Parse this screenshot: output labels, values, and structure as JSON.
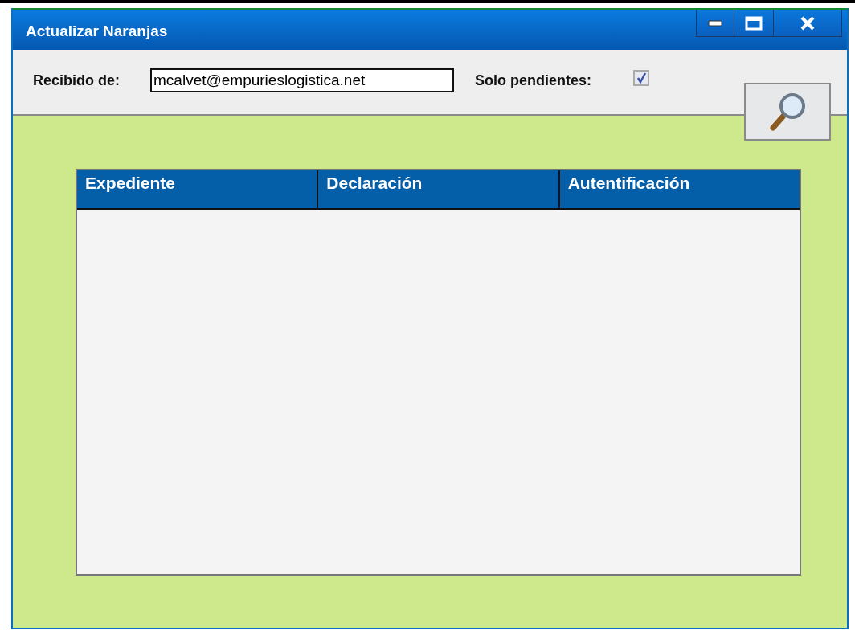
{
  "window": {
    "title": "Actualizar Naranjas"
  },
  "filter": {
    "sender_label": "Recibido de:",
    "sender_value": "mcalvet@empurieslogistica.net",
    "pending_label": "Solo pendientes:",
    "pending_checked": true
  },
  "table": {
    "columns": [
      "Expediente",
      "Declaración",
      "Autentificación"
    ]
  }
}
